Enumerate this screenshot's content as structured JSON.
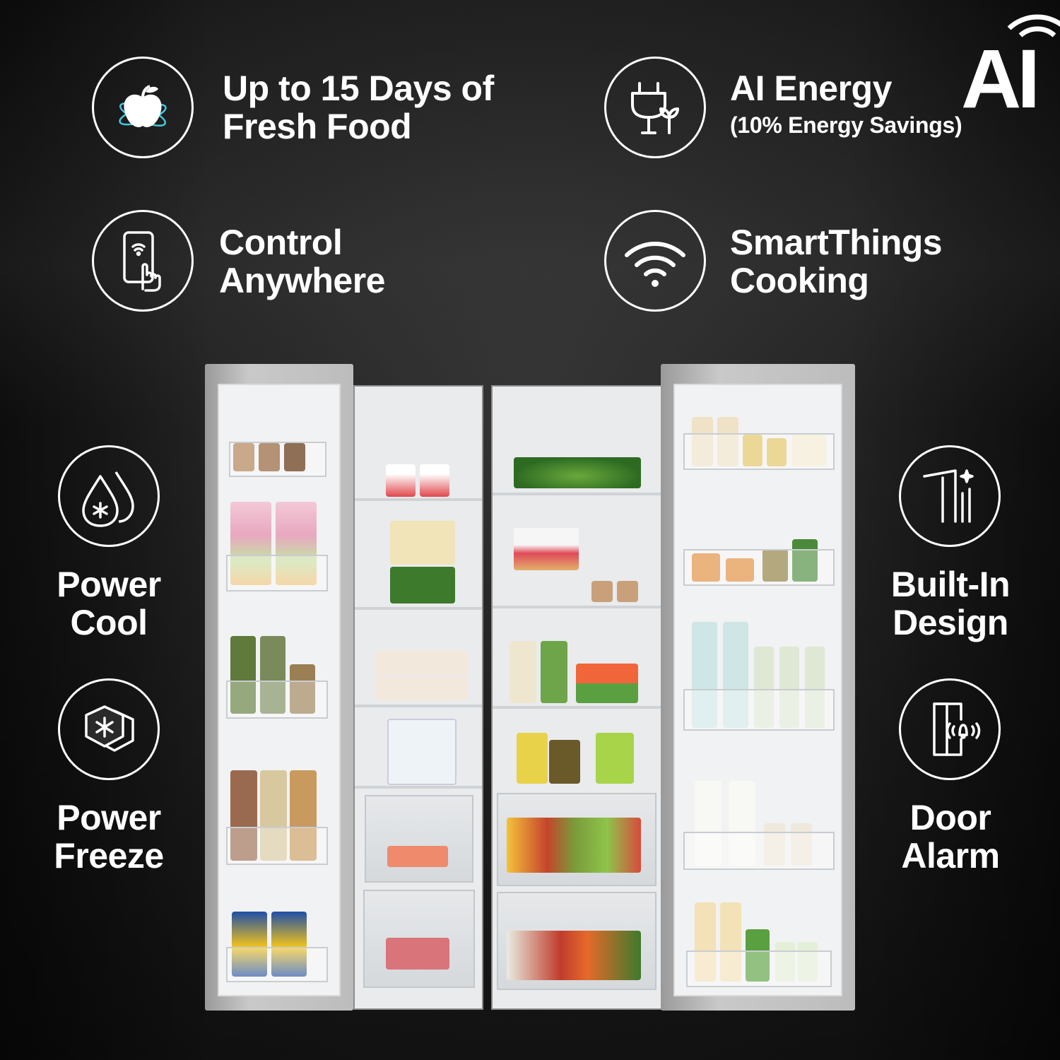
{
  "logo": {
    "text": "AI"
  },
  "features": {
    "fresh_food": {
      "line1": "Up to 15 Days of",
      "line2": "Fresh Food",
      "icon": "apple-icon"
    },
    "ai_energy": {
      "line1": "AI Energy",
      "line2": "(10% Energy Savings)",
      "icon": "plug-leaf-icon"
    },
    "control_anywhere": {
      "line1": "Control",
      "line2": "Anywhere",
      "icon": "phone-touch-icon"
    },
    "smartthings": {
      "line1": "SmartThings",
      "line2": "Cooking",
      "icon": "wifi-icon"
    },
    "power_cool": {
      "line1": "Power",
      "line2": "Cool",
      "icon": "droplet-snowflake-icon"
    },
    "built_in": {
      "line1": "Built-In",
      "line2": "Design",
      "icon": "built-in-icon"
    },
    "power_freeze": {
      "line1": "Power",
      "line2": "Freeze",
      "icon": "hexagon-snowflake-icon"
    },
    "door_alarm": {
      "line1": "Door",
      "line2": "Alarm",
      "icon": "door-bell-icon"
    }
  },
  "colors": {
    "icon_accent": "#46c9e0",
    "fridge_steel": "#b8b8b8",
    "interior": "#eef0f2"
  }
}
